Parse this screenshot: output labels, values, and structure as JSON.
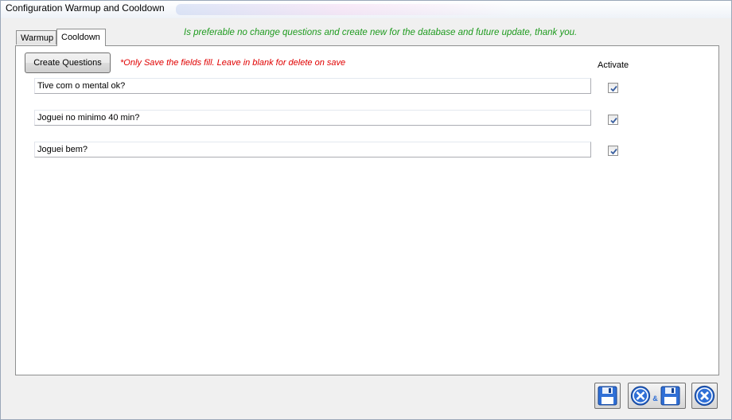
{
  "window": {
    "title": "Configuration Warmup and Cooldown"
  },
  "tabs": [
    {
      "label": "Warmup",
      "selected": false
    },
    {
      "label": "Cooldown",
      "selected": true
    }
  ],
  "notice": "Is preferable no change questions and create new for the database and future update, thank you.",
  "toolbar": {
    "create_label": "Create Questions",
    "hint": "*Only Save the fields fill. Leave in blank for delete on save",
    "activate_label": "Activate"
  },
  "questions": [
    {
      "text": "Tive com o mental ok?",
      "activated": true
    },
    {
      "text": "Joguei no minimo 40 min?",
      "activated": true
    },
    {
      "text": "Joguei bem?",
      "activated": true
    }
  ],
  "footer": {
    "save_icon": "floppy-disk-icon",
    "cancel_save_icon": "cancel-and-save-icon",
    "cancel_save_ampersand": "&",
    "close_icon": "close-x-icon"
  },
  "colors": {
    "notice": "#1e9a1e",
    "hint": "#e00000",
    "icon_blue": "#2f6fd6"
  }
}
